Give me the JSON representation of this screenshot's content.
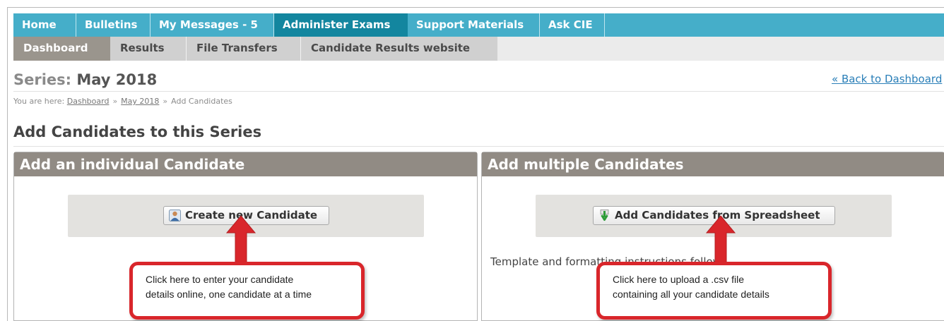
{
  "nav_primary": {
    "items": [
      {
        "label": "Home"
      },
      {
        "label": "Bulletins"
      },
      {
        "label": "My Messages - 5"
      },
      {
        "label": "Administer Exams"
      },
      {
        "label": "Support Materials"
      },
      {
        "label": "Ask CIE"
      }
    ],
    "active_index": 3
  },
  "nav_secondary": {
    "tabs": [
      {
        "label": "Dashboard"
      },
      {
        "label": "Results"
      },
      {
        "label": "File Transfers"
      },
      {
        "label": "Candidate Results website"
      }
    ],
    "active_index": 0
  },
  "page": {
    "series_label": "Series:",
    "series_value": "May 2018",
    "back_link": "« Back to Dashboard",
    "breadcrumb": {
      "prefix": "You are here:",
      "items": [
        "Dashboard",
        "May 2018",
        "Add Candidates"
      ],
      "separator": "»"
    },
    "heading": "Add Candidates to this Series"
  },
  "panels": {
    "individual": {
      "title": "Add an individual Candidate",
      "button_label": "Create new Candidate",
      "button_icon": "user-icon"
    },
    "multiple": {
      "title": "Add multiple Candidates",
      "button_label": "Add Candidates from Spreadsheet",
      "button_icon": "download-arrow-icon",
      "template_text": "Template and formatting instructions follow."
    }
  },
  "callouts": {
    "individual": {
      "line1": "Click here to enter your candidate",
      "line2": "details online, one candidate at a time"
    },
    "multiple": {
      "line1": "Click here to upload a .csv file",
      "line2": "containing all your candidate details"
    }
  },
  "colors": {
    "nav_primary": "#45aec9",
    "nav_primary_active": "#13869f",
    "tab_active": "#9a958d",
    "panel_header": "#918b84",
    "callout_red": "#d9262b",
    "link": "#2a7fb8"
  }
}
